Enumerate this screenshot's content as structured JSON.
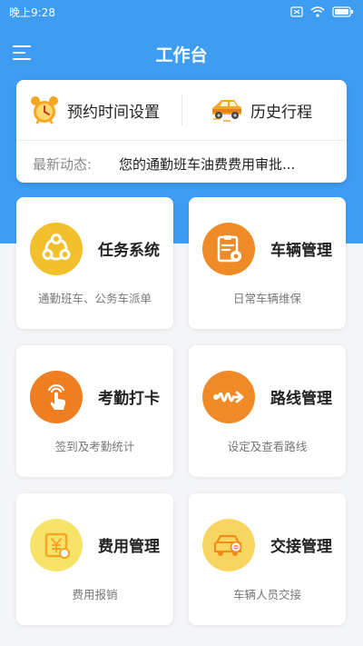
{
  "status_bar": {
    "time": "晚上9:28"
  },
  "header": {
    "title": "工作台"
  },
  "quick_actions": [
    {
      "label": "预约时间设置",
      "icon": "alarm-clock-icon"
    },
    {
      "label": "历史行程",
      "icon": "car-icon"
    }
  ],
  "news": {
    "label": "最新动态:",
    "text": "您的通勤班车油费费用审批..."
  },
  "tiles": [
    {
      "title": "任务系统",
      "desc": "通勤班车、公务车派单",
      "icon": "network-icon",
      "color": "#f1c02a"
    },
    {
      "title": "车辆管理",
      "desc": "日常车辆维保",
      "icon": "vehicle-doc-icon",
      "color": "#ef8a26"
    },
    {
      "title": "考勤打卡",
      "desc": "签到及考勤统计",
      "icon": "touch-hand-icon",
      "color": "#ef7e20"
    },
    {
      "title": "路线管理",
      "desc": "设定及查看路线",
      "icon": "route-icon",
      "color": "#ef8a26"
    },
    {
      "title": "费用管理",
      "desc": "费用报销",
      "icon": "yen-wallet-icon",
      "color": "#f7e26a"
    },
    {
      "title": "交接管理",
      "desc": "车辆人员交接",
      "icon": "car-swap-icon",
      "color": "#f7d560"
    }
  ]
}
